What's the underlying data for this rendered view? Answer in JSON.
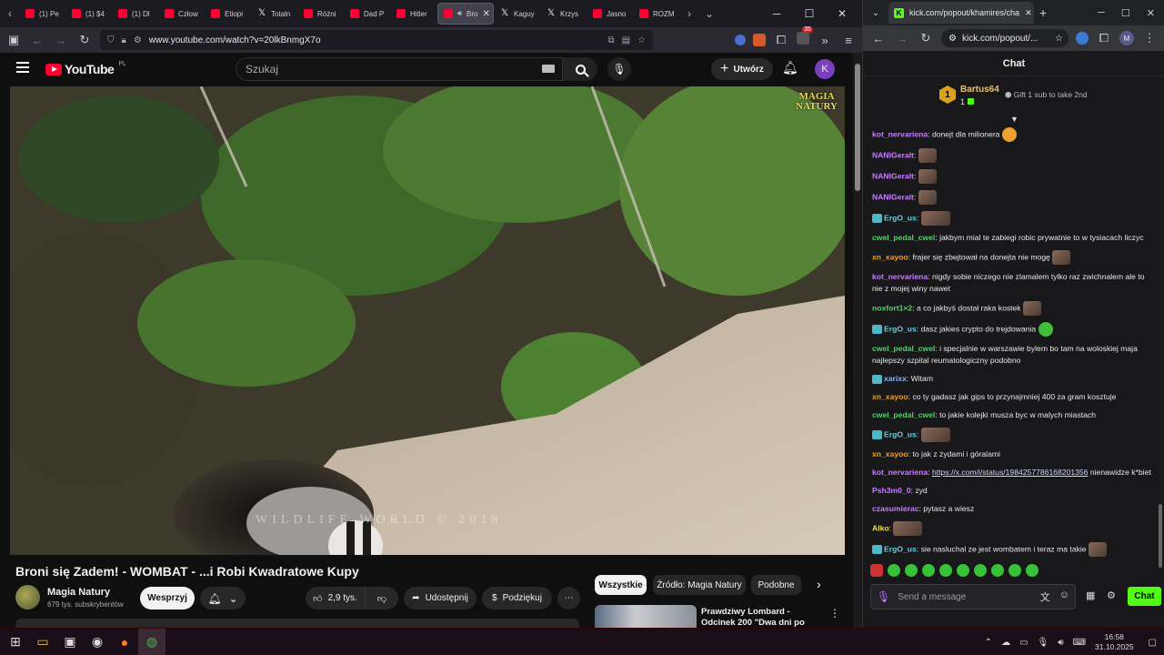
{
  "firefox": {
    "tabs": [
      {
        "label": "(1) Pe",
        "icon": "youtube-icon"
      },
      {
        "label": "(1) $4",
        "icon": "youtube-icon"
      },
      {
        "label": "(1) Dl",
        "icon": "youtube-icon"
      },
      {
        "label": "Człow",
        "icon": "youtube-icon"
      },
      {
        "label": "Etiopi",
        "icon": "youtube-icon"
      },
      {
        "label": "Totaln",
        "icon": "x-icon"
      },
      {
        "label": "Różni",
        "icon": "youtube-icon"
      },
      {
        "label": "Dad P",
        "icon": "youtube-icon"
      },
      {
        "label": "Hitler",
        "icon": "youtube-icon"
      },
      {
        "label": "Bro",
        "icon": "youtube-icon",
        "active": true
      },
      {
        "label": "Kaguy",
        "icon": "x-icon"
      },
      {
        "label": "Krzys",
        "icon": "x-icon"
      },
      {
        "label": "Jasno",
        "icon": "youtube-icon"
      },
      {
        "label": "ROZM",
        "icon": "youtube-icon"
      }
    ],
    "url": "www.youtube.com/watch?v=20lkBnmgX7o",
    "ext_badge": "35"
  },
  "youtube": {
    "logo_text": "YouTube",
    "logo_region": "PL",
    "search_placeholder": "Szukaj",
    "create_label": "Utwórz",
    "avatar_letter": "K",
    "video": {
      "watermark_line1": "MAGIA",
      "watermark_line2": "NATURY",
      "overlay_text": "WILDLIFE WORLD © 2018"
    },
    "title": "Broni się Zadem! - WOMBAT - ...i Robi Kwadratowe Kupy",
    "channel": {
      "name": "Magia Natury",
      "subs": "679 tys. subskrybentów"
    },
    "support_label": "Wesprzyj",
    "like_count": "2,9 tys.",
    "share_label": "Udostępnij",
    "thanks_label": "Podziękuj",
    "chips": [
      "Wszystkie",
      "Źródło: Magia Natury",
      "Podobne"
    ],
    "recommended": {
      "title": "Prawdziwy Lombard - Odcinek 200 \"Dwa dni po terminie\""
    }
  },
  "chrome": {
    "tab_title": "kick.com/popout/khamires/cha",
    "url": "kick.com/popout/...",
    "profile": "M"
  },
  "kick_chat": {
    "header": "Chat",
    "pinned": {
      "rank": "1",
      "user": "Bartus64",
      "count": "1",
      "gift_text": "Gift 1 sub to take 2nd"
    },
    "messages": [
      {
        "user": "kot_nervariena",
        "color": "#c77dff",
        "text": "donejt dla milionera",
        "emote": "rnd"
      },
      {
        "user": "NANIGeralt",
        "color": "#c77dff",
        "text": "",
        "emote": "std"
      },
      {
        "user": "NANIGeralt",
        "color": "#c77dff",
        "text": "",
        "emote": "std"
      },
      {
        "user": "NANIGeralt",
        "color": "#c77dff",
        "text": "",
        "emote": "std"
      },
      {
        "user": "ErgO_us",
        "color": "#5fd3e0",
        "text": "",
        "emote": "wide",
        "badge": true
      },
      {
        "user": "cwel_pedal_cwel",
        "color": "#53d16a",
        "text": "jakbym mial te zabiegi robic prywatnie to w tysiacach liczyc"
      },
      {
        "user": "xn_xayoo",
        "color": "#f0a020",
        "text": "frajer się zbejtował na donejta nie mogę",
        "emote": "std"
      },
      {
        "user": "kot_nervariena",
        "color": "#c77dff",
        "text": "nigdy sobie niczego nie zlamalem tylko raz zwichnalem ale to nie z mojej winy nawet"
      },
      {
        "user": "noxfort1×2",
        "color": "#53d16a",
        "text": "a co jakbyś dostał raka kostek",
        "emote": "std"
      },
      {
        "user": "ErgO_us",
        "color": "#5fd3e0",
        "text": "dasz jakies crypto do trejdowania",
        "emote": "rnd",
        "badge": true
      },
      {
        "user": "cwel_pedal_cwel",
        "color": "#53d16a",
        "text": "i specjalnie w warszawie bylem bo tam na woloskiej maja najlepszy szpital reumatologiczny podobno"
      },
      {
        "user": "xarixx",
        "color": "#8ab4ff",
        "text": "Witam",
        "badge": true
      },
      {
        "user": "xn_xayoo",
        "color": "#f0a020",
        "text": "co ty gadasz jak gips to przynajmniej 400 za gram kosztuje"
      },
      {
        "user": "cwel_pedal_cwel",
        "color": "#53d16a",
        "text": "to jakie kolejki musza byc w malych miastach"
      },
      {
        "user": "ErgO_us",
        "color": "#5fd3e0",
        "text": "",
        "emote": "wide",
        "badge": true
      },
      {
        "user": "xn_xayoo",
        "color": "#f0a020",
        "text": "to jak z żydami i góralami"
      },
      {
        "user": "kot_nervariena",
        "color": "#c77dff",
        "text": "nienawidze k*biet",
        "link": "https://x.com/i/status/1984257786168201356"
      },
      {
        "user": "Psh3m0_0",
        "color": "#c77dff",
        "text": "zyd"
      },
      {
        "user": "czasumierac",
        "color": "#c77dff",
        "text": "pytasz a wiesz"
      },
      {
        "user": "Alko",
        "color": "#f0e040",
        "text": "",
        "emote": "wide"
      },
      {
        "user": "ErgO_us",
        "color": "#5fd3e0",
        "text": "sie nasluchal ze jest wombatem i teraz ma takie",
        "emote": "std",
        "badge": true
      }
    ],
    "input_placeholder": "Send a message",
    "send_label": "Chat"
  },
  "taskbar": {
    "time": "16:58",
    "date": "31.10.2025"
  }
}
